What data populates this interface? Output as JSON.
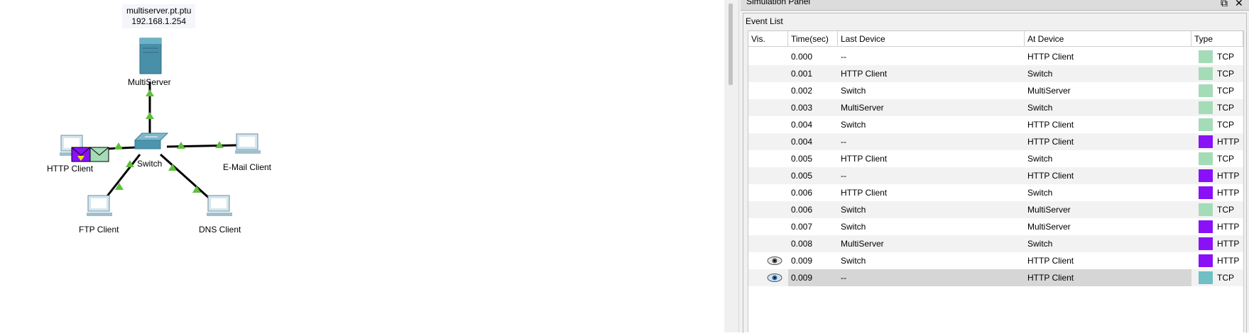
{
  "topology": {
    "tooltip": {
      "line1": "multiserver.pt.ptu",
      "line2": "192.168.1.254"
    },
    "devices": {
      "server": "MultiServer",
      "switch": "Switch",
      "http_client": "HTTP Client",
      "email_client": "E-Mail Client",
      "ftp_client": "FTP Client",
      "dns_client": "DNS Client"
    }
  },
  "panel": {
    "title": "Simulation Panel",
    "group_label": "Event List",
    "columns": [
      "Vis.",
      "Time(sec)",
      "Last Device",
      "At Device",
      "Type"
    ],
    "events": [
      {
        "time": "0.000",
        "last": "--",
        "at": "HTTP Client",
        "type": "TCP",
        "color": "#a4dcb7",
        "eye": ""
      },
      {
        "time": "0.001",
        "last": "HTTP Client",
        "at": "Switch",
        "type": "TCP",
        "color": "#a4dcb7",
        "eye": ""
      },
      {
        "time": "0.002",
        "last": "Switch",
        "at": "MultiServer",
        "type": "TCP",
        "color": "#a4dcb7",
        "eye": ""
      },
      {
        "time": "0.003",
        "last": "MultiServer",
        "at": "Switch",
        "type": "TCP",
        "color": "#a4dcb7",
        "eye": ""
      },
      {
        "time": "0.004",
        "last": "Switch",
        "at": "HTTP Client",
        "type": "TCP",
        "color": "#a4dcb7",
        "eye": ""
      },
      {
        "time": "0.004",
        "last": "--",
        "at": "HTTP Client",
        "type": "HTTP",
        "color": "#8a10f7",
        "eye": ""
      },
      {
        "time": "0.005",
        "last": "HTTP Client",
        "at": "Switch",
        "type": "TCP",
        "color": "#a4dcb7",
        "eye": ""
      },
      {
        "time": "0.005",
        "last": "--",
        "at": "HTTP Client",
        "type": "HTTP",
        "color": "#8a10f7",
        "eye": ""
      },
      {
        "time": "0.006",
        "last": "HTTP Client",
        "at": "Switch",
        "type": "HTTP",
        "color": "#8a10f7",
        "eye": ""
      },
      {
        "time": "0.006",
        "last": "Switch",
        "at": "MultiServer",
        "type": "TCP",
        "color": "#a4dcb7",
        "eye": ""
      },
      {
        "time": "0.007",
        "last": "Switch",
        "at": "MultiServer",
        "type": "HTTP",
        "color": "#8a10f7",
        "eye": ""
      },
      {
        "time": "0.008",
        "last": "MultiServer",
        "at": "Switch",
        "type": "HTTP",
        "color": "#8a10f7",
        "eye": ""
      },
      {
        "time": "0.009",
        "last": "Switch",
        "at": "HTTP Client",
        "type": "HTTP",
        "color": "#8a10f7",
        "eye": "eye-icon"
      },
      {
        "time": "0.009",
        "last": "--",
        "at": "HTTP Client",
        "type": "TCP",
        "color": "#6fbfc4",
        "eye": "eye-icon-active",
        "selected": true
      }
    ]
  }
}
